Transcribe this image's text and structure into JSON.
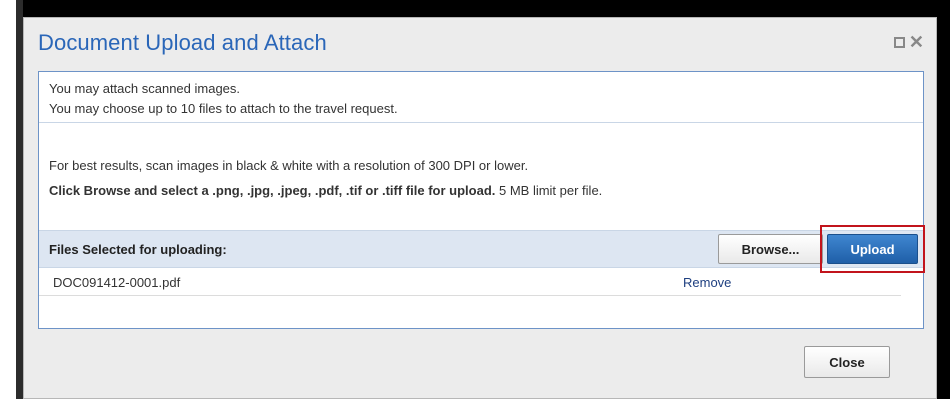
{
  "dialog": {
    "title": "Document Upload and Attach",
    "window_controls": [
      "maximize-icon",
      "close-icon"
    ]
  },
  "info": {
    "line1": "You may attach scanned images.",
    "line2": "You may choose up to 10 files to attach to the travel request."
  },
  "hints": {
    "resolution": "For best results, scan images in black & white with a resolution of 300 DPI or lower.",
    "formats_bold": "Click Browse and select a .png, .jpg, .jpeg, .pdf, .tif or .tiff file for upload.",
    "formats_rest": " 5 MB limit per file."
  },
  "files": {
    "header": "Files Selected for uploading:",
    "browse_label": "Browse...",
    "upload_label": "Upload",
    "items": [
      {
        "name": "DOC091412-0001.pdf",
        "remove_label": "Remove"
      }
    ]
  },
  "footer": {
    "close_label": "Close"
  },
  "colors": {
    "title": "#2a66b8",
    "panel_border": "#6d93c7",
    "upload_button": "#2b6fbd",
    "highlight": "#c2141c"
  }
}
